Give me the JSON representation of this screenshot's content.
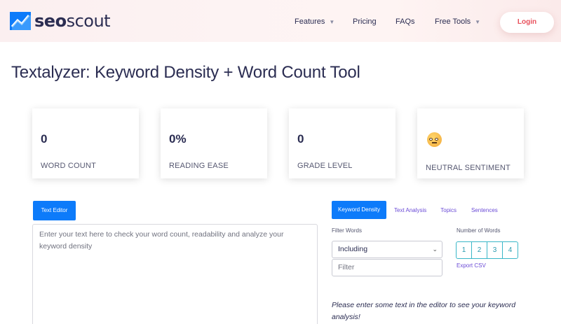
{
  "header": {
    "logo_text_bold": "seo",
    "logo_text_rest": "scout",
    "nav": [
      {
        "label": "Features",
        "has_caret": true
      },
      {
        "label": "Pricing",
        "has_caret": false
      },
      {
        "label": "FAQs",
        "has_caret": false
      },
      {
        "label": "Free Tools",
        "has_caret": true
      }
    ],
    "login_label": "Login"
  },
  "page": {
    "title": "Textalyzer: Keyword Density + Word Count Tool"
  },
  "stats": [
    {
      "value": "0",
      "label": "WORD COUNT"
    },
    {
      "value": "0%",
      "label": "READING EASE"
    },
    {
      "value": "0",
      "label": "GRADE LEVEL"
    },
    {
      "label": "NEUTRAL SENTIMENT",
      "icon": "neutral-face-icon"
    }
  ],
  "editor": {
    "tab_label": "Text Editor",
    "placeholder": "Enter your text here to check your word count, readability and analyze your keyword density"
  },
  "analysis": {
    "tabs": [
      {
        "label": "Keyword Density",
        "active": true
      },
      {
        "label": "Text Analysis",
        "active": false
      },
      {
        "label": "Topics",
        "active": false
      },
      {
        "label": "Sentences",
        "active": false
      }
    ],
    "filter_words_label": "Filter Words",
    "filter_select_value": "Including",
    "filter_input_placeholder": "Filter",
    "number_of_words_label": "Number of Words",
    "number_options": [
      "1",
      "2",
      "3",
      "4"
    ],
    "export_label": "Export CSV",
    "empty_message": "Please enter some text in the editor to see your keyword analysis!"
  },
  "colors": {
    "primary_blue": "#0d7bfa",
    "login_red": "#e8505b",
    "link_purple": "#6a4ad6",
    "teal": "#3ab7c8",
    "text_dark": "#2b2d52"
  }
}
